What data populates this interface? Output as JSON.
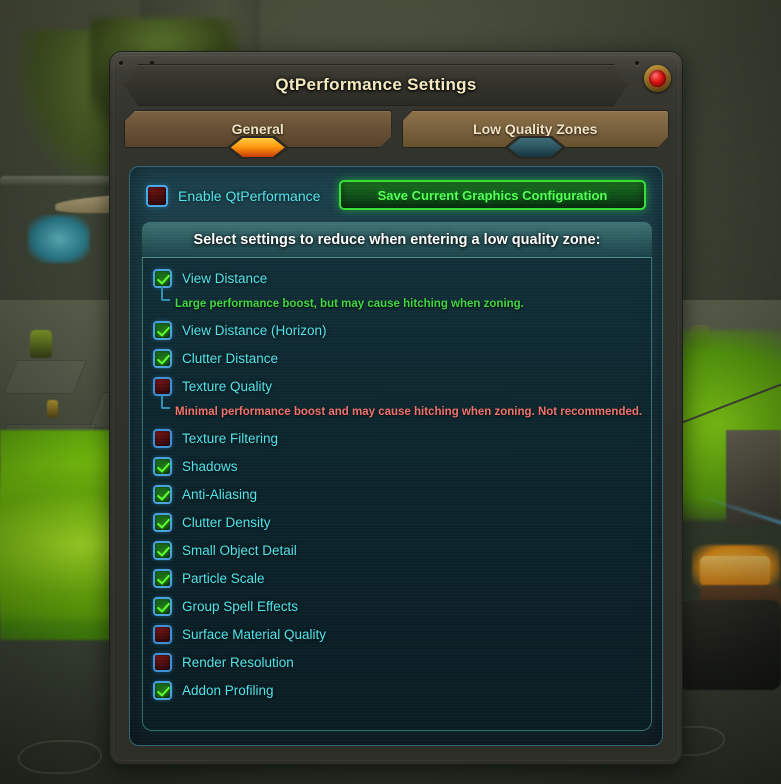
{
  "window": {
    "title": "QtPerformance Settings",
    "close_icon": "close-gem-icon"
  },
  "tabs": [
    {
      "label": "General",
      "active": true
    },
    {
      "label": "Low Quality Zones",
      "active": false
    }
  ],
  "toolbar": {
    "enable_label": "Enable QtPerformance",
    "enable_checked": false,
    "save_label": "Save Current Graphics Configuration"
  },
  "section": {
    "header": "Select settings to reduce when entering a low quality zone:"
  },
  "settings": [
    {
      "label": "View Distance",
      "checked": true,
      "hint": "Large performance boost, but may cause hitching when zoning.",
      "hint_type": "good"
    },
    {
      "label": "View Distance (Horizon)",
      "checked": true
    },
    {
      "label": "Clutter Distance",
      "checked": true
    },
    {
      "label": "Texture Quality",
      "checked": false,
      "hint": "Minimal performance boost and may cause hitching when zoning.  Not recommended.",
      "hint_type": "warn"
    },
    {
      "label": "Texture Filtering",
      "checked": false
    },
    {
      "label": "Shadows",
      "checked": true
    },
    {
      "label": "Anti-Aliasing",
      "checked": true
    },
    {
      "label": "Clutter Density",
      "checked": true
    },
    {
      "label": "Small Object Detail",
      "checked": true
    },
    {
      "label": "Particle Scale",
      "checked": true
    },
    {
      "label": "Group Spell Effects",
      "checked": true
    },
    {
      "label": "Surface Material Quality",
      "checked": false
    },
    {
      "label": "Render Resolution",
      "checked": false
    },
    {
      "label": "Addon Profiling",
      "checked": true
    }
  ],
  "colors": {
    "label_teal": "#4fe3e8",
    "hint_good": "#3fd63f",
    "hint_warn": "#f0726b",
    "save_green": "#57ff57",
    "tab_active_gem": "#ff9b10",
    "tab_inactive_gem": "#2b5460",
    "title_gold": "#f4e9bf"
  }
}
